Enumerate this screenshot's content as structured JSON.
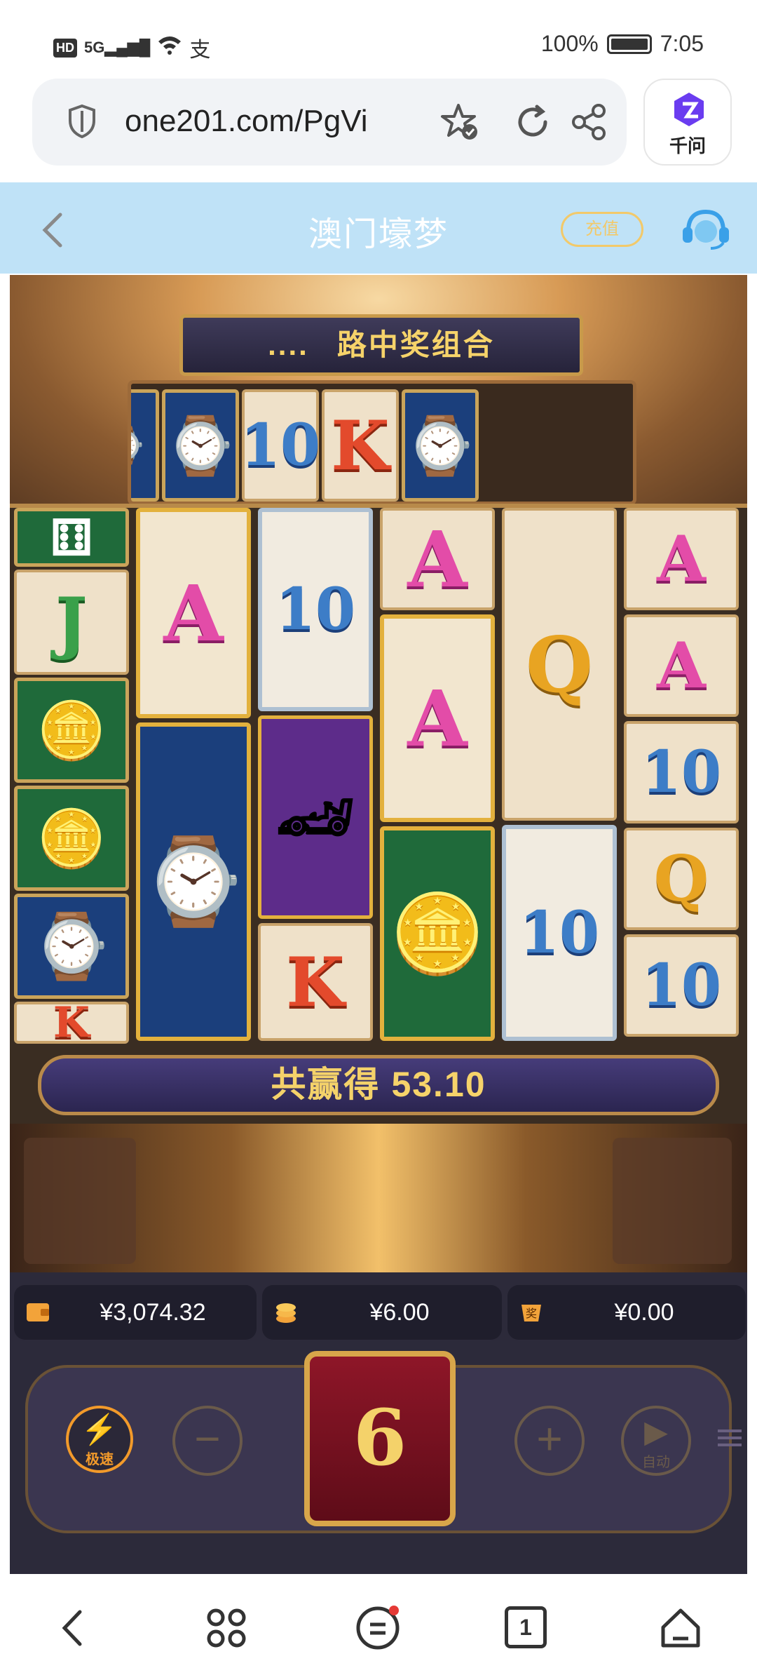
{
  "status_bar": {
    "left_icons": [
      "hd-icon",
      "signal-5g-icon",
      "wifi-icon",
      "alipay-icon"
    ],
    "hd_label": "HD",
    "network": "5G",
    "battery_percent": "100%",
    "time": "7:05"
  },
  "browser": {
    "url": "one201.com/PgVi",
    "qianwen_label": "千问"
  },
  "app_header": {
    "title": "澳门壕梦",
    "recharge_label": "充值"
  },
  "game": {
    "banner_text": "路中奖组合",
    "banner_dots": "....",
    "top_row": [
      "watch",
      "watch",
      "10",
      "K",
      "watch"
    ],
    "reels": [
      [
        "dice",
        "J",
        "chips",
        "chips",
        "watch",
        "K"
      ],
      [
        "A",
        "watch"
      ],
      [
        "10",
        "car",
        "K"
      ],
      [
        "A",
        "A",
        "chips"
      ],
      [
        "Q",
        "10"
      ],
      [
        "A",
        "A",
        "10",
        "Q",
        "10"
      ]
    ],
    "win_label": "共赢得",
    "win_amount": "53.10",
    "balance": "¥3,074.32",
    "bet": "¥6.00",
    "last_win": "¥0.00",
    "turbo_label": "极速",
    "auto_label": "自动",
    "spin_value": "6"
  },
  "nav_bar": {
    "tab_count": "1"
  },
  "colors": {
    "header_bg": "#bfe2f7",
    "gold": "#f4d26a",
    "spin_red": "#8e1628"
  }
}
